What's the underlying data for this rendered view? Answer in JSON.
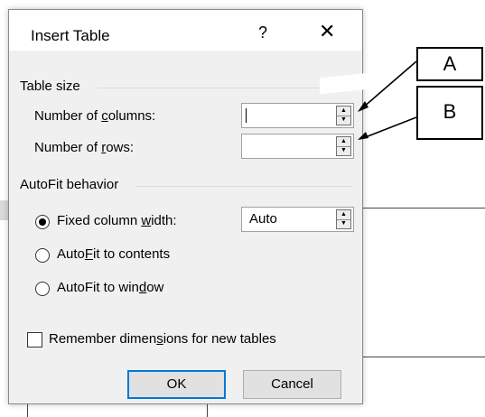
{
  "dialog": {
    "title": "Insert Table",
    "help_icon": "?",
    "close_icon": "✕"
  },
  "table_size": {
    "group_label": "Table size",
    "columns": {
      "label_pre": "Number of ",
      "label_ul": "c",
      "label_post": "olumns:",
      "value": ""
    },
    "rows": {
      "label_pre": "Number of ",
      "label_ul": "r",
      "label_post": "ows:",
      "value": ""
    }
  },
  "autofit": {
    "group_label": "AutoFit behavior",
    "options": [
      {
        "pre": "Fixed column ",
        "ul": "w",
        "post": "idth:",
        "selected": true
      },
      {
        "pre": "Auto",
        "ul": "F",
        "post": "it to contents",
        "selected": false
      },
      {
        "pre": "AutoFit to win",
        "ul": "d",
        "post": "ow",
        "selected": false
      }
    ],
    "fixed_width_value": "Auto"
  },
  "remember": {
    "pre": "Remember dimen",
    "ul": "s",
    "post": "ions for new tables",
    "checked": false
  },
  "buttons": {
    "ok": "OK",
    "cancel": "Cancel"
  },
  "annotations": {
    "a": "A",
    "b": "B"
  },
  "colors": {
    "accent": "#0078d7",
    "body_bg": "#f0f0f0"
  }
}
